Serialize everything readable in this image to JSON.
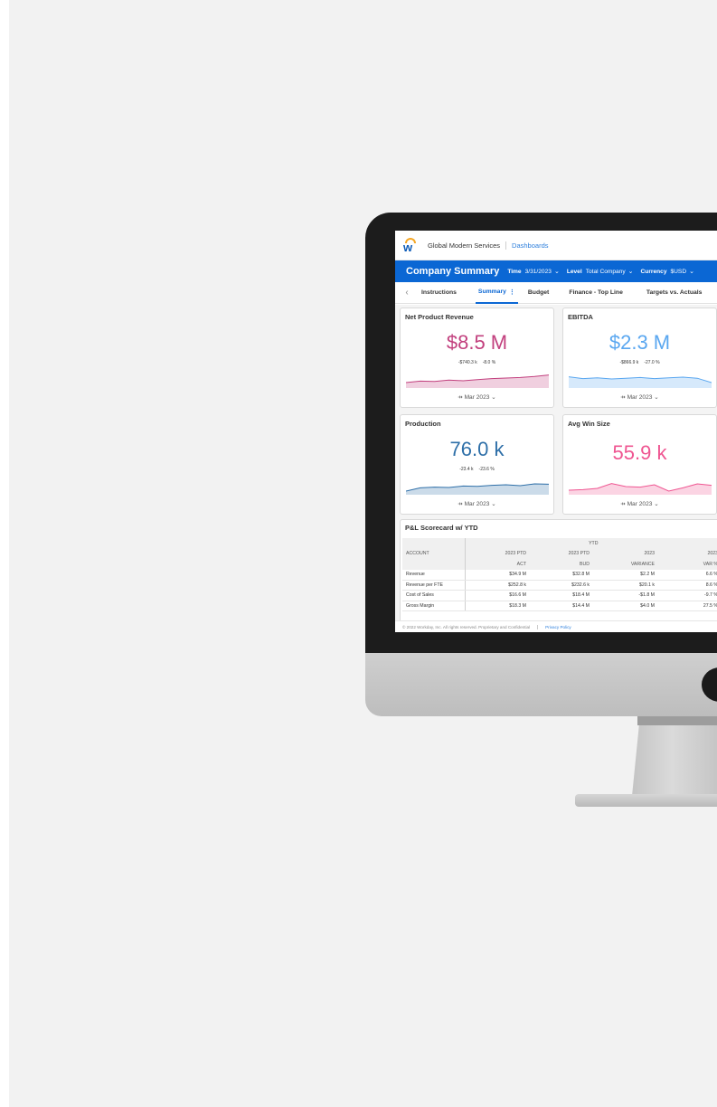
{
  "app": {
    "org_name": "Global Modern Services",
    "breadcrumb": "Dashboards"
  },
  "header": {
    "title": "Company Summary",
    "filters": [
      {
        "label": "Time",
        "value": "3/31/2023"
      },
      {
        "label": "Level",
        "value": "Total Company"
      },
      {
        "label": "Currency",
        "value": "$USD"
      }
    ]
  },
  "tabs": [
    {
      "label": "Instructions",
      "active": false
    },
    {
      "label": "Summary",
      "active": true
    },
    {
      "label": "Budget",
      "active": false
    },
    {
      "label": "Finance - Top Line",
      "active": false
    },
    {
      "label": "Targets vs. Actuals",
      "active": false
    }
  ],
  "cards": [
    {
      "title": "Net Product Revenue",
      "value": "$8.5 M",
      "delta_abs": "-$740.3 k",
      "delta_pct": "-8.0 %",
      "period": "Mar 2023",
      "color": "#c2407e",
      "spark": [
        0.3,
        0.38,
        0.36,
        0.44,
        0.4,
        0.46,
        0.52,
        0.55,
        0.58,
        0.64,
        0.72
      ]
    },
    {
      "title": "EBITDA",
      "value": "$2.3 M",
      "delta_abs": "-$866.9 k",
      "delta_pct": "-27.0 %",
      "period": "Mar 2023",
      "color": "#5aa7f0",
      "spark": [
        0.62,
        0.52,
        0.56,
        0.5,
        0.54,
        0.58,
        0.52,
        0.56,
        0.6,
        0.54,
        0.3
      ]
    },
    {
      "title": "Production",
      "value": "76.0 k",
      "delta_abs": "-23.4 k",
      "delta_pct": "-23.6 %",
      "period": "Mar 2023",
      "color": "#2e6fa8",
      "spark": [
        0.2,
        0.38,
        0.42,
        0.4,
        0.48,
        0.46,
        0.52,
        0.55,
        0.5,
        0.6,
        0.58
      ]
    },
    {
      "title": "Avg Win Size",
      "value": "55.9 k",
      "delta_abs": "",
      "delta_pct": "",
      "period": "Mar 2023",
      "color": "#ef5591",
      "spark": [
        0.25,
        0.28,
        0.35,
        0.62,
        0.45,
        0.42,
        0.55,
        0.2,
        0.38,
        0.6,
        0.52
      ]
    }
  ],
  "scorecard": {
    "title": "P&L Scorecard w/ YTD",
    "group_header": "YTD",
    "columns": [
      {
        "line1": "",
        "line2": "ACCOUNT"
      },
      {
        "line1": "2023 PTD",
        "line2": "ACT"
      },
      {
        "line1": "2023 PTD",
        "line2": "BUD"
      },
      {
        "line1": "2023",
        "line2": "VARIANCE"
      },
      {
        "line1": "2023",
        "line2": "VAR %"
      }
    ],
    "rows": [
      [
        "Revenue",
        "$34.9 M",
        "$32.8 M",
        "$2.2 M",
        "6.6 %"
      ],
      [
        "Revenue per FTE",
        "$252.8 k",
        "$232.6 k",
        "$20.1 k",
        "8.6 %"
      ],
      [
        "Cost of Sales",
        "$16.6 M",
        "$18.4 M",
        "-$1.8 M",
        "-9.7 %"
      ],
      [
        "Gross Margin",
        "$18.3 M",
        "$14.4 M",
        "$4.0 M",
        "27.5 %"
      ]
    ]
  },
  "footer": {
    "copyright": "© 2022 Workday, Inc. All rights reserved. Proprietary and Confidential",
    "privacy": "Privacy Policy"
  }
}
